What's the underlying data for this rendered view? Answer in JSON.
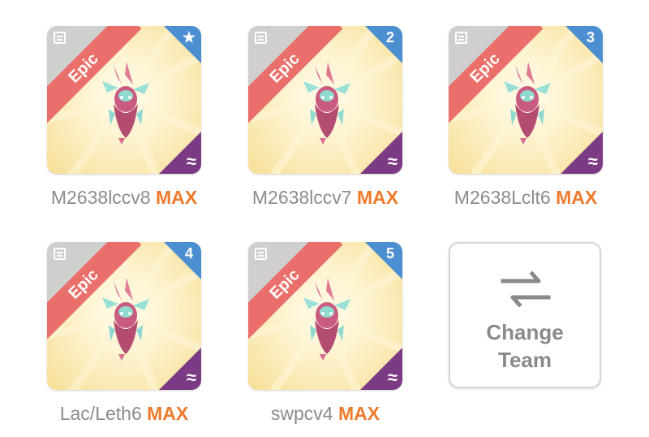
{
  "cards": [
    {
      "rarity": "Epic",
      "badge": "★",
      "name": "M2638lccv8",
      "level": "MAX"
    },
    {
      "rarity": "Epic",
      "badge": "2",
      "name": "M2638lccv7",
      "level": "MAX"
    },
    {
      "rarity": "Epic",
      "badge": "3",
      "name": "M2638Lclt6",
      "level": "MAX"
    },
    {
      "rarity": "Epic",
      "badge": "4",
      "name": "Lac/Leth6",
      "level": "MAX"
    },
    {
      "rarity": "Epic",
      "badge": "5",
      "name": "swpcv4",
      "level": "MAX"
    }
  ],
  "icons": {
    "top_left": "notes-icon",
    "bottom_right": "element-wave-icon",
    "change": "swap-arrows-icon"
  },
  "change_team": {
    "line1": "Change",
    "line2": "Team"
  },
  "colors": {
    "epic_ribbon": "#ea6f6a",
    "slot_badge": "#4c8fd1",
    "element_corner": "#7d3a84",
    "max_text": "#ee7a2c",
    "name_text": "#8c8c8c"
  }
}
